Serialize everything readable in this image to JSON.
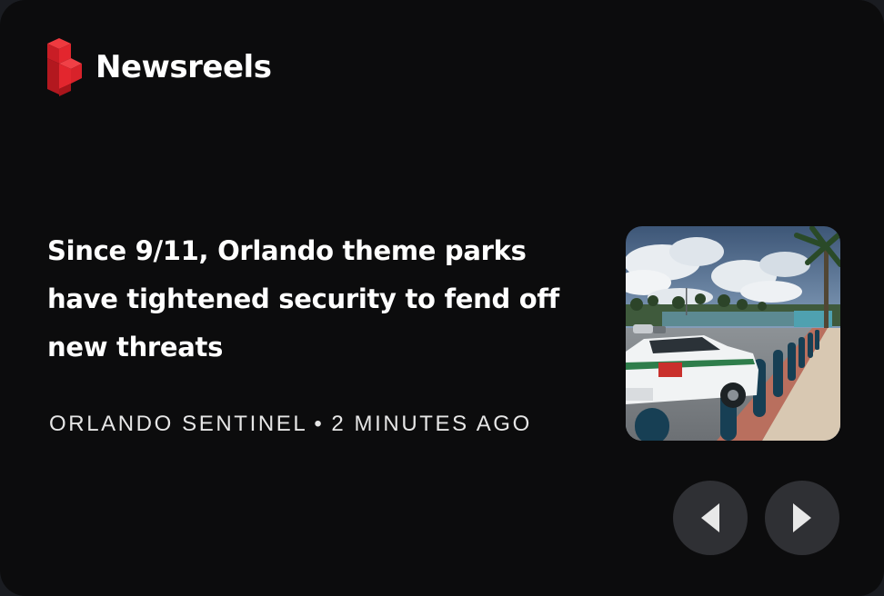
{
  "brand": {
    "name": "Newsreels",
    "logo_colors": [
      "#e3262e",
      "#a9151b"
    ]
  },
  "article": {
    "headline": "Since 9/11, Orlando theme parks have tightened security to fend off new threats",
    "source": "ORLANDO SENTINEL",
    "separator": "•",
    "time_ago": "2 MINUTES AGO",
    "thumbnail_description": "Police car parked beside bollards at a theme park entrance"
  },
  "navigation": {
    "prev_icon": "chevron-left-icon",
    "next_icon": "chevron-right-icon"
  },
  "colors": {
    "card_background": "#0c0c0d",
    "nav_button": "#2f3034",
    "text": "#ffffff"
  }
}
